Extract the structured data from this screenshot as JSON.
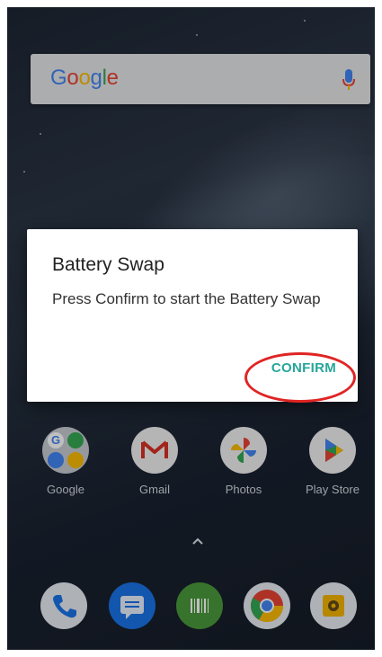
{
  "search": {
    "brand": "Google",
    "brand_colors": [
      "#4285f4",
      "#ea4335",
      "#fbbc05",
      "#4285f4",
      "#34a853",
      "#ea4335"
    ]
  },
  "dialog": {
    "title": "Battery Swap",
    "message": "Press Confirm to start the Battery Swap",
    "confirm_label": "CONFIRM"
  },
  "apps": [
    {
      "label": "Google",
      "icon": "google-folder-icon"
    },
    {
      "label": "Gmail",
      "icon": "gmail-icon"
    },
    {
      "label": "Photos",
      "icon": "photos-icon"
    },
    {
      "label": "Play Store",
      "icon": "play-store-icon"
    }
  ],
  "dock": [
    {
      "icon": "phone-icon"
    },
    {
      "icon": "messages-icon"
    },
    {
      "icon": "barcode-scanner-icon"
    },
    {
      "icon": "chrome-icon"
    },
    {
      "icon": "camera-icon"
    }
  ],
  "colors": {
    "accent": "#26a69a",
    "highlight": "#e02424"
  }
}
